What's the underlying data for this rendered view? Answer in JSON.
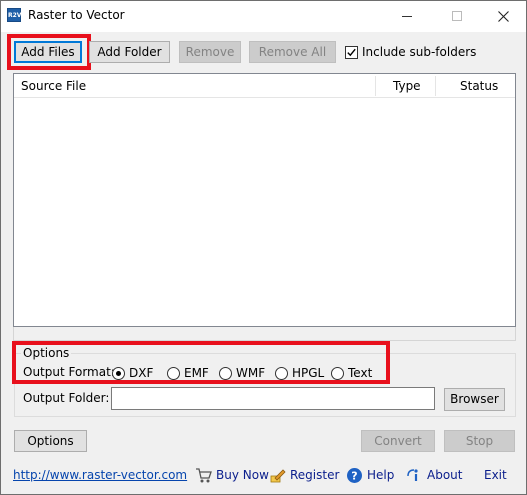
{
  "window": {
    "title": "Raster to Vector",
    "app_icon_text": "R2V"
  },
  "toolbar": {
    "add_files": "Add Files",
    "add_folder": "Add Folder",
    "remove": "Remove",
    "remove_all": "Remove All",
    "include_subfolders_label": "Include sub-folders",
    "include_subfolders_checked": true
  },
  "file_list": {
    "columns": [
      "Source File",
      "Type",
      "Status"
    ],
    "rows": []
  },
  "options": {
    "group_label": "Options",
    "output_format_label": "Output Format:",
    "formats": [
      "DXF",
      "EMF",
      "WMF",
      "HPGL",
      "Text"
    ],
    "selected_format": "DXF",
    "output_folder_label": "Output Folder:",
    "output_folder_value": "",
    "browser_button": "Browser"
  },
  "actions": {
    "options_button": "Options",
    "convert_button": "Convert",
    "stop_button": "Stop"
  },
  "footer": {
    "website": "http://www.raster-vector.com",
    "buy_now": "Buy Now",
    "register": "Register",
    "help": "Help",
    "about": "About",
    "exit": "Exit"
  },
  "colors": {
    "highlight": "#e8101c",
    "link": "#0645ad",
    "focus_border": "#0078d7"
  }
}
